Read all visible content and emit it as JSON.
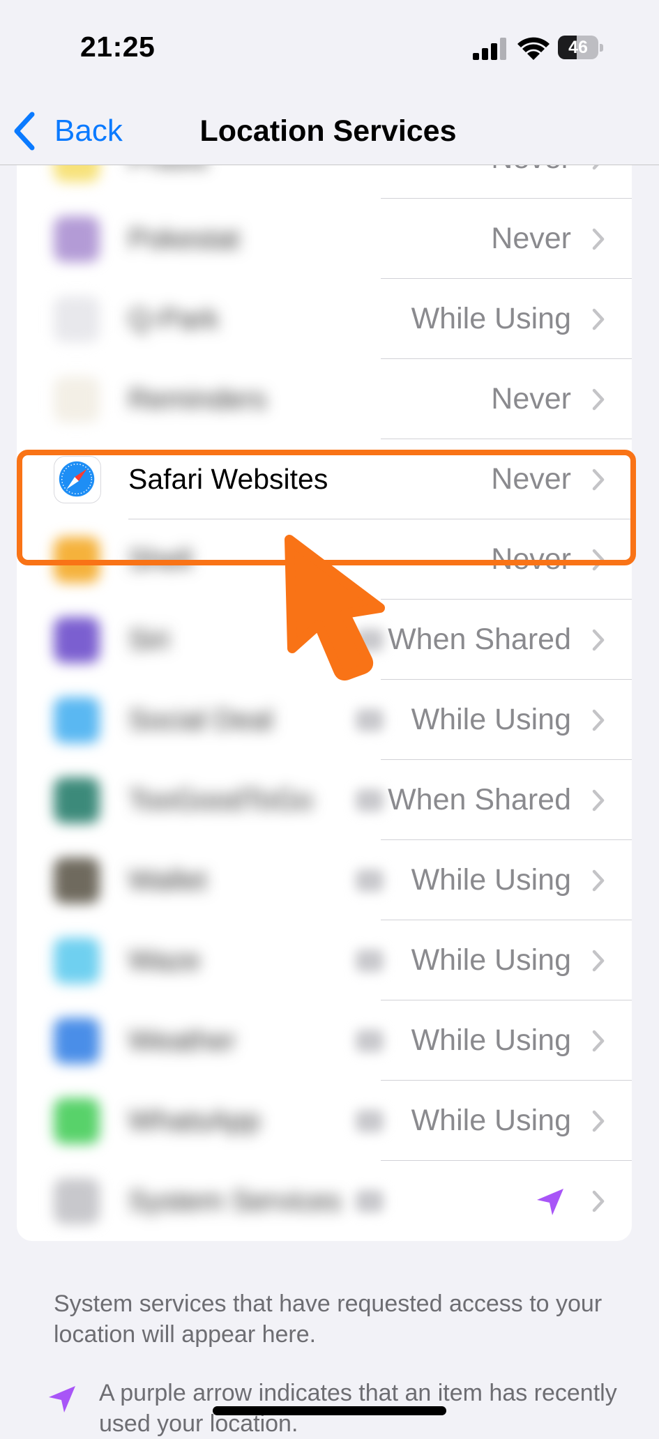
{
  "status_bar": {
    "time": "21:25",
    "battery_level": "46"
  },
  "nav": {
    "back_label": "Back",
    "title": "Location Services"
  },
  "rows": [
    {
      "name": "Prasis",
      "value": "Never",
      "icon_color": "#f7e27a"
    },
    {
      "name": "Pokestat",
      "value": "Never",
      "icon_color": "#b39bd6"
    },
    {
      "name": "Q-Park",
      "value": "While Using",
      "icon_color": "#e8e8ec"
    },
    {
      "name": "Reminders",
      "value": "Never",
      "icon_color": "#f3efe6"
    },
    {
      "name": "Safari Websites",
      "value": "Never",
      "icon_color": "#2a8cf5"
    },
    {
      "name": "Shell",
      "value": "Never",
      "icon_color": "#f5b23c"
    },
    {
      "name": "Siri",
      "value": "When Shared",
      "icon_color": "#7b5fd0"
    },
    {
      "name": "Social Deal",
      "value": "While Using",
      "icon_color": "#5ab8f2"
    },
    {
      "name": "TooGoodToGo",
      "value": "When Shared",
      "icon_color": "#3c8a7a"
    },
    {
      "name": "Wallet",
      "value": "While Using",
      "icon_color": "#6f6a5e"
    },
    {
      "name": "Waze",
      "value": "While Using",
      "icon_color": "#6fd0f0"
    },
    {
      "name": "Weather",
      "value": "While Using",
      "icon_color": "#4a8ee8"
    },
    {
      "name": "WhatsApp",
      "value": "While Using",
      "icon_color": "#58d26a"
    },
    {
      "name": "System Services",
      "value": "",
      "icon_color": "#c8c8cc"
    }
  ],
  "footer": {
    "system_note": "System services that have requested access to your location will appear here.",
    "legend_text": "A purple arrow indicates that an item has recently used your location."
  },
  "colors": {
    "accent": "#0a7aff",
    "highlight": "#f97316",
    "location_arrow": "#a855f7",
    "value_text": "#8a8a8e"
  },
  "icons": {
    "back": "chevron-left-icon",
    "row_chevron": "chevron-right-icon",
    "location": "location-arrow-icon",
    "safari": "safari-compass-icon"
  }
}
